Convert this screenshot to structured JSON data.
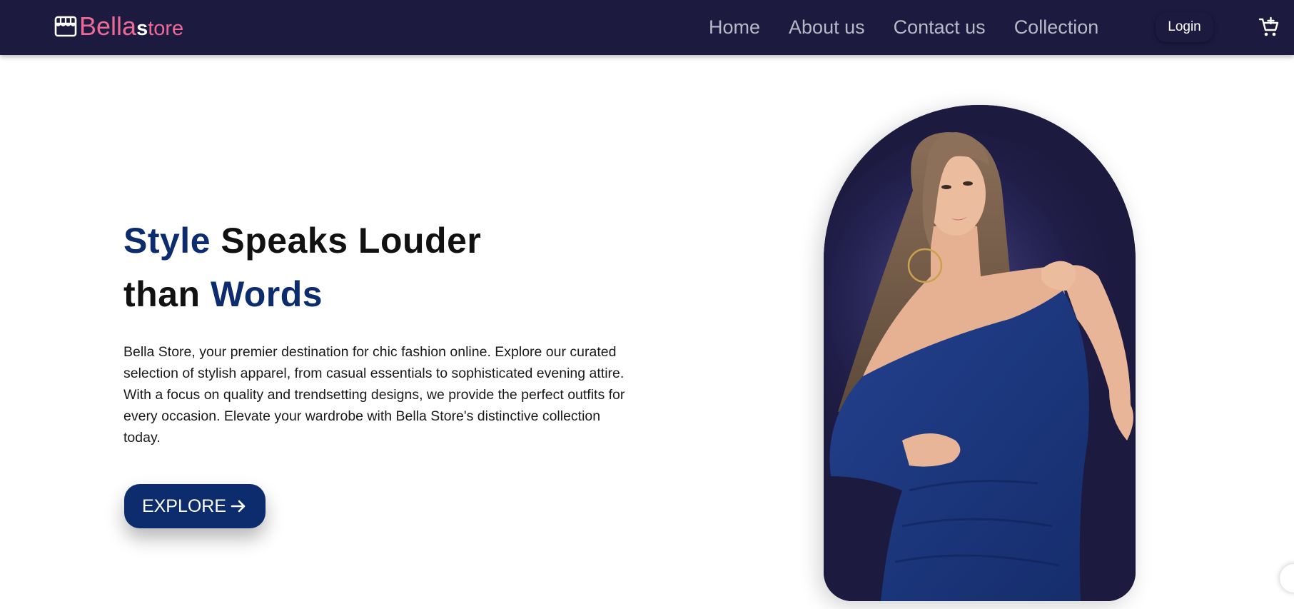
{
  "brand": {
    "name_part1": "Bella",
    "name_part2": "s",
    "name_part3": "tore",
    "icon": "storefront-icon",
    "color": "#ec6a96"
  },
  "nav": {
    "links": [
      {
        "label": "Home"
      },
      {
        "label": "About us"
      },
      {
        "label": "Contact us"
      },
      {
        "label": "Collection"
      }
    ],
    "login_label": "Login",
    "cart_icon": "add-to-cart-icon",
    "background": "#1c1a3f"
  },
  "hero": {
    "title_word1": "Style",
    "title_rest1": " Speaks Louder",
    "title_word2": "than ",
    "title_word3": "Words",
    "description": "Bella Store, your premier destination for chic fashion online. Explore our curated selection of stylish apparel, from casual essentials to sophisticated evening attire. With a focus on quality and trendsetting designs, we provide the perfect outfits for every occasion. Elevate your wardrobe with Bella Store's distinctive collection today.",
    "cta_label": "EXPLORE",
    "cta_icon": "arrow-right-icon",
    "accent_color": "#0d2c6e"
  },
  "hero_image": {
    "description_icon": "model-photo"
  }
}
